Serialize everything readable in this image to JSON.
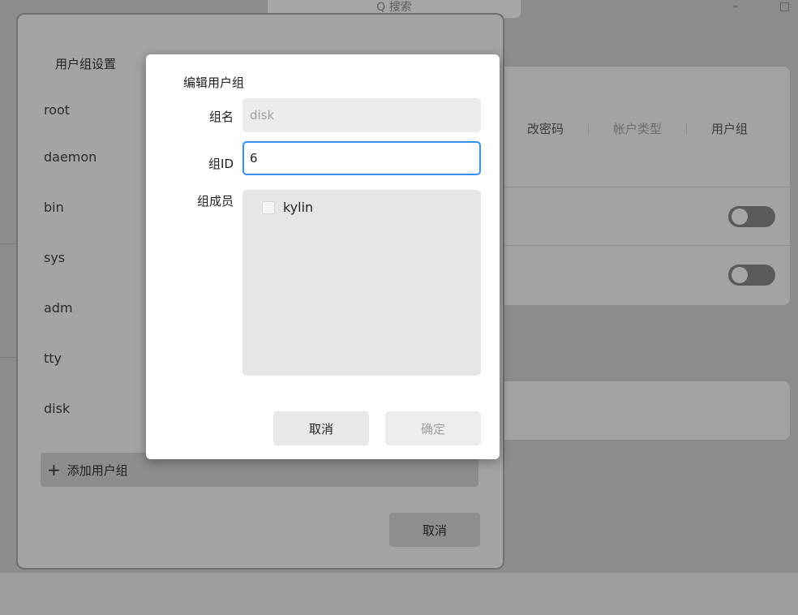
{
  "background": {
    "search_placeholder": "Q 搜索",
    "window_controls": [
      "–",
      "□"
    ],
    "tabs": [
      {
        "label": "改密码",
        "dim": false
      },
      {
        "label": "帐户类型",
        "dim": true
      },
      {
        "label": "用户组",
        "dim": false
      }
    ]
  },
  "group_dialog": {
    "title": "用户组设置",
    "groups": [
      "root",
      "daemon",
      "bin",
      "sys",
      "adm",
      "tty",
      "disk"
    ],
    "add_button": {
      "icon": "+",
      "label": "添加用户组"
    },
    "cancel_label": "取消"
  },
  "edit_dialog": {
    "title": "编辑用户组",
    "name_label": "组名",
    "name_value": "disk",
    "id_label": "组ID",
    "id_value": "6",
    "members_label": "组成员",
    "members": [
      {
        "name": "kylin",
        "checked": false
      }
    ],
    "cancel_label": "取消",
    "confirm_label": "确定"
  },
  "colors": {
    "accent": "#3790fa",
    "overlay": "#9d9d9d",
    "dialog_bg": "#ffffff"
  }
}
